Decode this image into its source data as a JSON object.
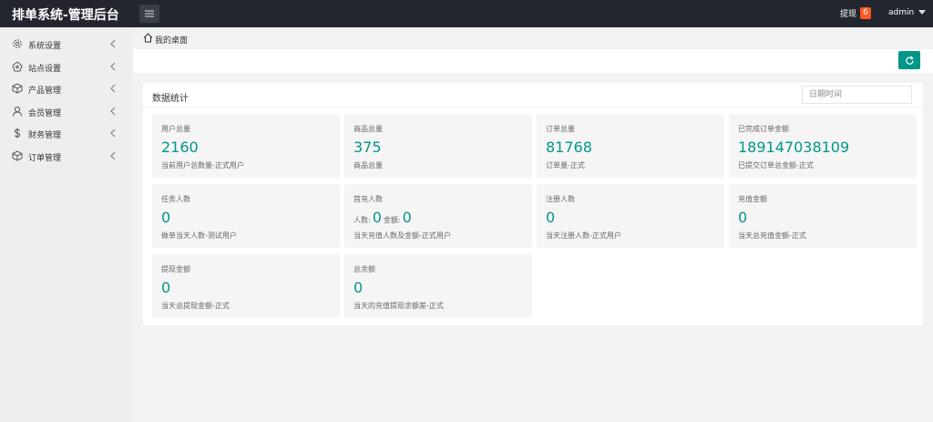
{
  "app": {
    "title": "排单系统-管理后台"
  },
  "header": {
    "withdraw_label": "提现",
    "withdraw_count": "6",
    "user_name": "admin"
  },
  "sidebar": {
    "items": [
      {
        "label": "系统设置",
        "icon": "gear-icon"
      },
      {
        "label": "站点设置",
        "icon": "site-icon"
      },
      {
        "label": "产品管理",
        "icon": "box-icon"
      },
      {
        "label": "会员管理",
        "icon": "user-icon"
      },
      {
        "label": "财务管理",
        "icon": "dollar-icon"
      },
      {
        "label": "订单管理",
        "icon": "box-icon"
      }
    ]
  },
  "breadcrumb": {
    "label": "我的桌面"
  },
  "panel": {
    "title": "数据统计",
    "date_placeholder": "日期时间"
  },
  "cards": [
    {
      "title": "用户总量",
      "value": "2160",
      "desc": "当前用户总数量-正式用户"
    },
    {
      "title": "商品总量",
      "value": "375",
      "desc": "商品总量"
    },
    {
      "title": "订单总量",
      "value": "81768",
      "desc": "订单量-正式"
    },
    {
      "title": "已完成订单金额",
      "value": "189147038109",
      "desc": "已提交订单总金额-正式"
    },
    {
      "title": "任务人数",
      "value": "0",
      "desc": "做单当天人数-测试用户"
    },
    {
      "title": "首充人数",
      "people_label": "人数:",
      "people_value": "0",
      "amount_label": "金额:",
      "amount_value": "0",
      "desc": "当天充值人数及金额-正式用户"
    },
    {
      "title": "注册人数",
      "value": "0",
      "desc": "当天注册人数-正式用户"
    },
    {
      "title": "充值金额",
      "value": "0",
      "desc": "当天总充值金额-正式"
    },
    {
      "title": "提现金额",
      "value": "0",
      "desc": "当天总提现金额-正式"
    },
    {
      "title": "总余额",
      "value": "0",
      "desc": "当天的充值提现余额差-正式"
    }
  ],
  "colors": {
    "accent": "#009688",
    "topbar": "#23262e",
    "badge": "#ff5722"
  }
}
